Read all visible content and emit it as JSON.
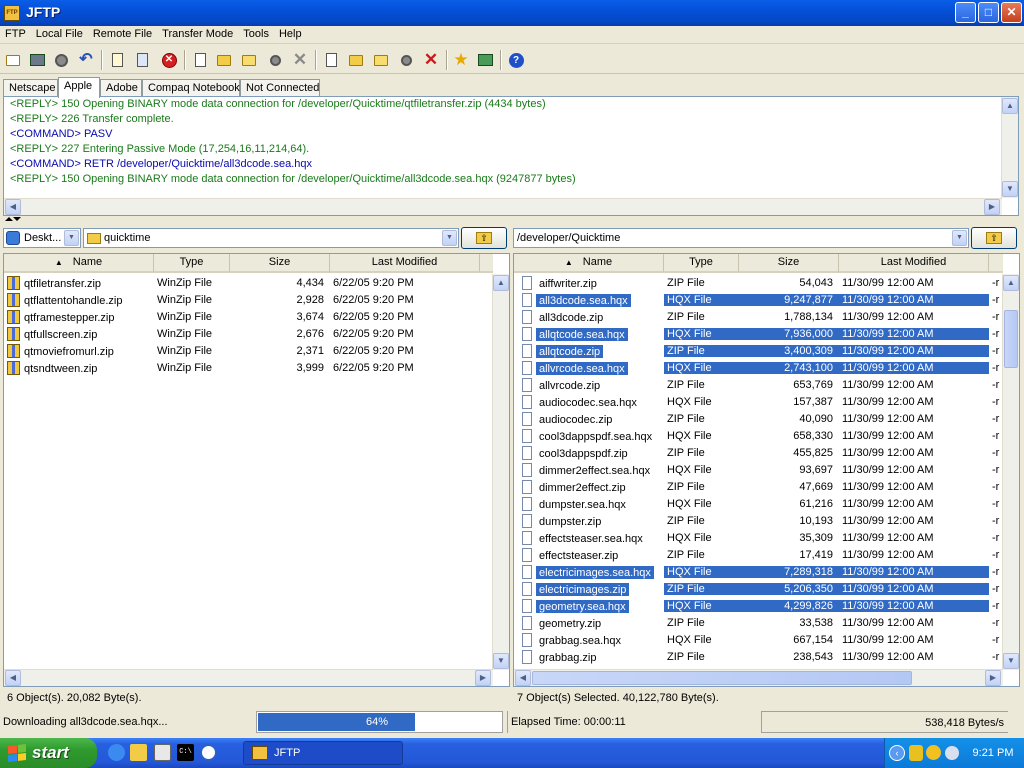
{
  "window": {
    "title": "JFTP",
    "app_icon_text": "FTP",
    "minimize": "_",
    "maximize": "□",
    "close": "✕"
  },
  "menu": [
    "FTP",
    "Local File",
    "Remote File",
    "Transfer Mode",
    "Tools",
    "Help"
  ],
  "tabs": [
    "Netscape",
    "Apple",
    "Adobe",
    "Compaq Notebook",
    "Not Connected"
  ],
  "active_tab": 1,
  "log": [
    {
      "kind": "reply",
      "text": "<REPLY> 150 Opening BINARY mode data connection for /developer/Quicktime/qtfiletransfer.zip (4434 bytes)"
    },
    {
      "kind": "reply",
      "text": "<REPLY> 226 Transfer complete."
    },
    {
      "kind": "cmd",
      "text": "<COMMAND> PASV"
    },
    {
      "kind": "reply",
      "text": "<REPLY> 227 Entering Passive Mode (17,254,16,11,214,64)."
    },
    {
      "kind": "cmd",
      "text": "<COMMAND> RETR /developer/Quicktime/all3dcode.sea.hqx"
    },
    {
      "kind": "reply",
      "text": "<REPLY> 150 Opening BINARY mode data connection for /developer/Quicktime/all3dcode.sea.hqx (9247877 bytes)"
    }
  ],
  "local": {
    "drive": "Deskt...",
    "folder": "quicktime",
    "columns": [
      "Name",
      "Type",
      "Size",
      "Last Modified"
    ],
    "files": [
      {
        "name": "qtfiletransfer.zip",
        "type": "WinZip File",
        "size": "4,434",
        "modified": "6/22/05 9:20 PM"
      },
      {
        "name": "qtflattentohandle.zip",
        "type": "WinZip File",
        "size": "2,928",
        "modified": "6/22/05 9:20 PM"
      },
      {
        "name": "qtframestepper.zip",
        "type": "WinZip File",
        "size": "3,674",
        "modified": "6/22/05 9:20 PM"
      },
      {
        "name": "qtfullscreen.zip",
        "type": "WinZip File",
        "size": "2,676",
        "modified": "6/22/05 9:20 PM"
      },
      {
        "name": "qtmoviefromurl.zip",
        "type": "WinZip File",
        "size": "2,371",
        "modified": "6/22/05 9:20 PM"
      },
      {
        "name": "qtsndtween.zip",
        "type": "WinZip File",
        "size": "3,999",
        "modified": "6/22/05 9:20 PM"
      }
    ],
    "status": "6 Object(s). 20,082 Byte(s)."
  },
  "remote": {
    "path": "/developer/Quicktime",
    "columns": [
      "Name",
      "Type",
      "Size",
      "Last Modified"
    ],
    "perm": "-r",
    "files": [
      {
        "name": "aiffwriter.zip",
        "type": "ZIP File",
        "size": "54,043",
        "modified": "11/30/99 12:00 AM",
        "selected": false
      },
      {
        "name": "all3dcode.sea.hqx",
        "type": "HQX File",
        "size": "9,247,877",
        "modified": "11/30/99 12:00 AM",
        "selected": true
      },
      {
        "name": "all3dcode.zip",
        "type": "ZIP File",
        "size": "1,788,134",
        "modified": "11/30/99 12:00 AM",
        "selected": false
      },
      {
        "name": "allqtcode.sea.hqx",
        "type": "HQX File",
        "size": "7,936,000",
        "modified": "11/30/99 12:00 AM",
        "selected": true
      },
      {
        "name": "allqtcode.zip",
        "type": "ZIP File",
        "size": "3,400,309",
        "modified": "11/30/99 12:00 AM",
        "selected": true
      },
      {
        "name": "allvrcode.sea.hqx",
        "type": "HQX File",
        "size": "2,743,100",
        "modified": "11/30/99 12:00 AM",
        "selected": true
      },
      {
        "name": "allvrcode.zip",
        "type": "ZIP File",
        "size": "653,769",
        "modified": "11/30/99 12:00 AM",
        "selected": false
      },
      {
        "name": "audiocodec.sea.hqx",
        "type": "HQX File",
        "size": "157,387",
        "modified": "11/30/99 12:00 AM",
        "selected": false
      },
      {
        "name": "audiocodec.zip",
        "type": "ZIP File",
        "size": "40,090",
        "modified": "11/30/99 12:00 AM",
        "selected": false
      },
      {
        "name": "cool3dappspdf.sea.hqx",
        "type": "HQX File",
        "size": "658,330",
        "modified": "11/30/99 12:00 AM",
        "selected": false
      },
      {
        "name": "cool3dappspdf.zip",
        "type": "ZIP File",
        "size": "455,825",
        "modified": "11/30/99 12:00 AM",
        "selected": false
      },
      {
        "name": "dimmer2effect.sea.hqx",
        "type": "HQX File",
        "size": "93,697",
        "modified": "11/30/99 12:00 AM",
        "selected": false
      },
      {
        "name": "dimmer2effect.zip",
        "type": "ZIP File",
        "size": "47,669",
        "modified": "11/30/99 12:00 AM",
        "selected": false
      },
      {
        "name": "dumpster.sea.hqx",
        "type": "HQX File",
        "size": "61,216",
        "modified": "11/30/99 12:00 AM",
        "selected": false
      },
      {
        "name": "dumpster.zip",
        "type": "ZIP File",
        "size": "10,193",
        "modified": "11/30/99 12:00 AM",
        "selected": false
      },
      {
        "name": "effectsteaser.sea.hqx",
        "type": "HQX File",
        "size": "35,309",
        "modified": "11/30/99 12:00 AM",
        "selected": false
      },
      {
        "name": "effectsteaser.zip",
        "type": "ZIP File",
        "size": "17,419",
        "modified": "11/30/99 12:00 AM",
        "selected": false
      },
      {
        "name": "electricimages.sea.hqx",
        "type": "HQX File",
        "size": "7,289,318",
        "modified": "11/30/99 12:00 AM",
        "selected": true
      },
      {
        "name": "electricimages.zip",
        "type": "ZIP File",
        "size": "5,206,350",
        "modified": "11/30/99 12:00 AM",
        "selected": true
      },
      {
        "name": "geometry.sea.hqx",
        "type": "HQX File",
        "size": "4,299,826",
        "modified": "11/30/99 12:00 AM",
        "selected": true
      },
      {
        "name": "geometry.zip",
        "type": "ZIP File",
        "size": "33,538",
        "modified": "11/30/99 12:00 AM",
        "selected": false
      },
      {
        "name": "grabbag.sea.hqx",
        "type": "HQX File",
        "size": "667,154",
        "modified": "11/30/99 12:00 AM",
        "selected": false
      },
      {
        "name": "grabbag.zip",
        "type": "ZIP File",
        "size": "238,543",
        "modified": "11/30/99 12:00 AM",
        "selected": false
      }
    ],
    "status": "7 Object(s) Selected. 40,122,780 Byte(s)."
  },
  "transfer": {
    "status": "Downloading all3dcode.sea.hqx...",
    "progress": 0.64,
    "progress_label": "64%",
    "elapsed": "Elapsed Time: 00:00:11",
    "rate": "538,418 Bytes/s"
  },
  "taskbar": {
    "start_label": "start",
    "task_label": "JFTP",
    "quicklaunch_cmd_text": "C:\\",
    "clock": "9:21 PM"
  },
  "colors": {
    "selection": "#316ac5",
    "reply": "#1a7a1a",
    "command": "#0a0ab0",
    "progress": "#316ac5"
  }
}
